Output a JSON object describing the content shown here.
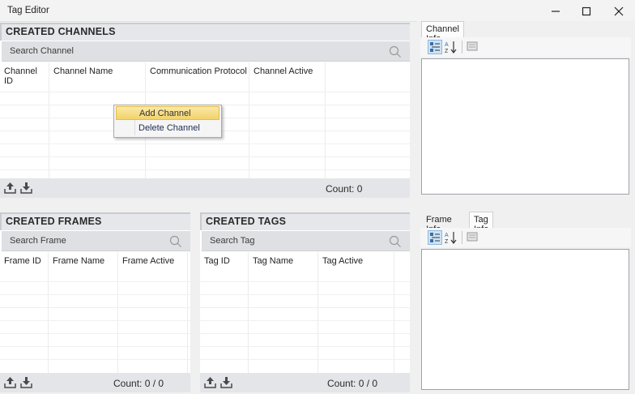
{
  "window": {
    "title": "Tag Editor"
  },
  "channels": {
    "title": "CREATED CHANNELS",
    "search_placeholder": "Search Channel",
    "columns": [
      "Channel ID",
      "Channel Name",
      "Communication Protocol",
      "Channel Active"
    ],
    "count": "Count: 0"
  },
  "context_menu": {
    "items": [
      "Add Channel",
      "Delete Channel"
    ]
  },
  "frames": {
    "title": "CREATED FRAMES",
    "search_placeholder": "Search Frame",
    "columns": [
      "Frame ID",
      "Frame Name",
      "Frame Active"
    ],
    "count": "Count: 0 / 0"
  },
  "tags": {
    "title": "CREATED TAGS",
    "search_placeholder": "Search Tag",
    "columns": [
      "Tag ID",
      "Tag Name",
      "Tag Active"
    ],
    "count": "Count: 0 / 0"
  },
  "channel_info": {
    "tabs": [
      "Channel Info"
    ]
  },
  "frame_tag_info": {
    "tabs": [
      "Frame Info",
      "Tag Info"
    ],
    "active_tab": "Tag Info"
  },
  "icons": {
    "minimize": "minimize-icon",
    "maximize": "maximize-icon",
    "close": "close-icon",
    "search": "search-icon",
    "upload": "upload-icon",
    "download": "download-icon",
    "categorized": "categorized-icon",
    "sort_az": "sort-az-icon",
    "property_pages": "property-pages-icon"
  }
}
